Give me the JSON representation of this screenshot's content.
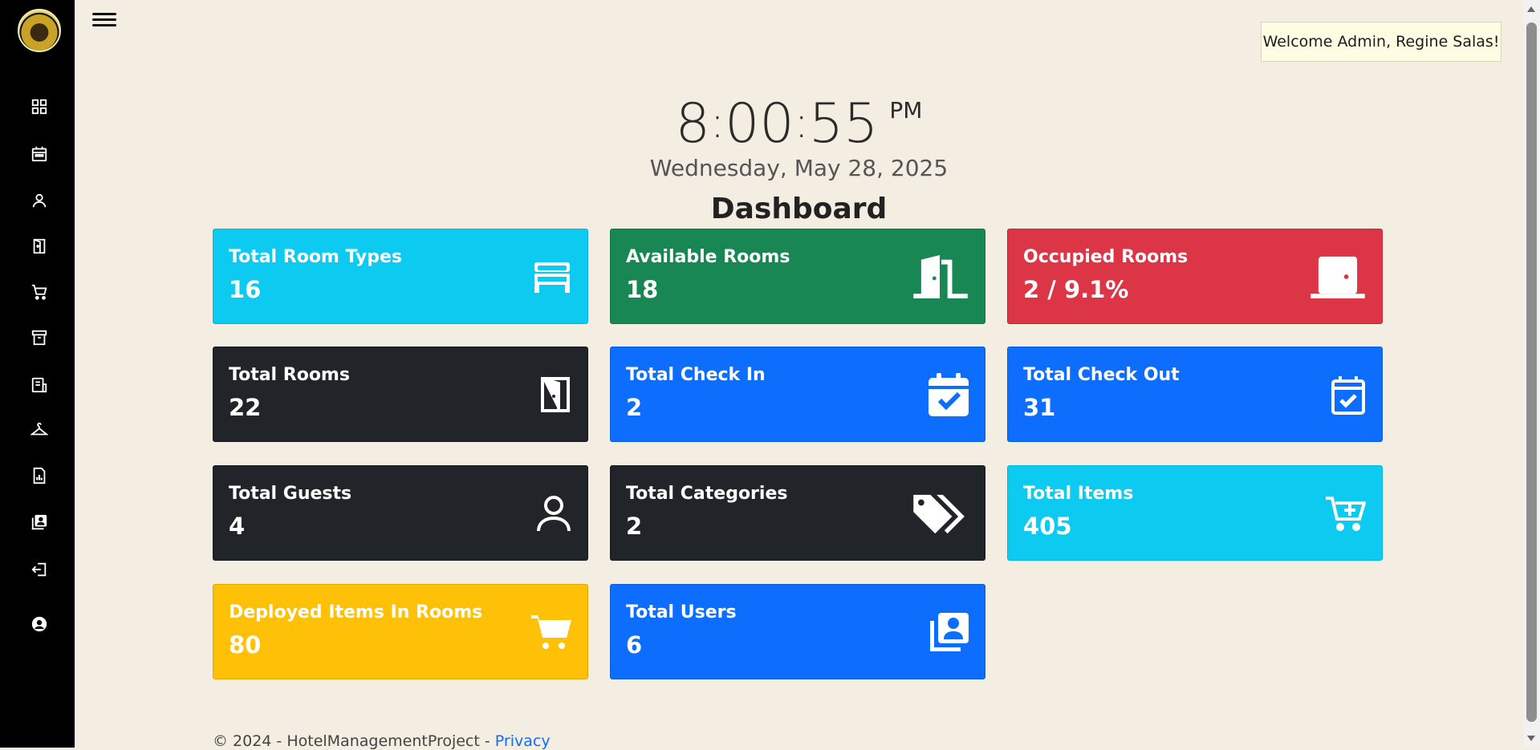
{
  "header": {
    "welcome": "Welcome Admin, Regine Salas!"
  },
  "clock": {
    "hour": "8",
    "minutes": "00",
    "seconds": "55",
    "ampm": "PM",
    "date": "Wednesday, May 28, 2025"
  },
  "page": {
    "title": "Dashboard"
  },
  "sidebar": {
    "items": [
      {
        "icon": "dashboard-icon"
      },
      {
        "icon": "calendar-icon"
      },
      {
        "icon": "user-icon"
      },
      {
        "icon": "door-icon"
      },
      {
        "icon": "cart-icon"
      },
      {
        "icon": "archive-icon"
      },
      {
        "icon": "receipt-icon"
      },
      {
        "icon": "hanger-icon"
      },
      {
        "icon": "report-icon"
      },
      {
        "icon": "users-icon"
      },
      {
        "icon": "logout-icon"
      },
      {
        "icon": "account-icon"
      }
    ]
  },
  "cards": [
    {
      "label": "Total Room Types",
      "value": "16",
      "color": "#0dcaf0",
      "icon": "bed-icon"
    },
    {
      "label": "Available Rooms",
      "value": "18",
      "color": "#198754",
      "icon": "door-open-icon"
    },
    {
      "label": "Occupied Rooms",
      "value": "2 / 9.1%",
      "color": "#dc3545",
      "icon": "door-closed-icon"
    },
    {
      "label": "Total Rooms",
      "value": "22",
      "color": "#212529",
      "icon": "door-icon"
    },
    {
      "label": "Total Check In",
      "value": "2",
      "color": "#0d6efd",
      "icon": "calendar-check-icon"
    },
    {
      "label": "Total Check Out",
      "value": "31",
      "color": "#0d6efd",
      "icon": "calendar-check-outline-icon"
    },
    {
      "label": "Total Guests",
      "value": "4",
      "color": "#212529",
      "icon": "person-icon"
    },
    {
      "label": "Total Categories",
      "value": "2",
      "color": "#212529",
      "icon": "tags-icon"
    },
    {
      "label": "Total Items",
      "value": "405",
      "color": "#0dcaf0",
      "icon": "cart-plus-icon"
    },
    {
      "label": "Deployed Items In Rooms",
      "value": "80",
      "color": "#ffc107",
      "icon": "cart-icon"
    },
    {
      "label": "Total Users",
      "value": "6",
      "color": "#0d6efd",
      "icon": "users-icon"
    }
  ],
  "footer": {
    "text": "© 2024 - HotelManagementProject - ",
    "privacy_link": "Privacy"
  }
}
